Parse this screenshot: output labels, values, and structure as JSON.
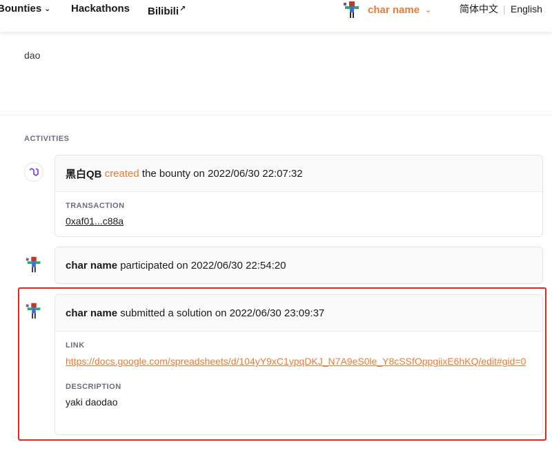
{
  "nav": {
    "bounties": "Bounties",
    "hackathons": "Hackathons",
    "bilibili": "Bilibili",
    "user_name": "char name",
    "lang_zh": "简体中文",
    "lang_sep": "|",
    "lang_en": "English"
  },
  "description_text": "dao",
  "activities": {
    "title": "ACTIVITIES",
    "items": [
      {
        "actor": "黑白QB",
        "verb": "created",
        "rest": "the bounty on 2022/06/30 22:07:32",
        "field_label": "TRANSACTION",
        "field_value": "0xaf01...c88a",
        "icon": "polygon-icon"
      },
      {
        "actor": "char name",
        "rest": "participated on 2022/06/30 22:54:20",
        "icon": "avatar"
      },
      {
        "actor": "char name",
        "rest": "submitted a solution on 2022/06/30 23:09:37",
        "link_label": "LINK",
        "link": "https://docs.google.com/spreadsheets/d/104yY9xC1ypqDKJ_N7A9eS0le_Y8cSSfOppgiixE6hKQ/edit#gid=0",
        "description_label": "DESCRIPTION",
        "description": "yaki daodao",
        "icon": "avatar"
      }
    ]
  },
  "colors": {
    "accent": "#e87b35",
    "highlight": "#e8231c"
  }
}
